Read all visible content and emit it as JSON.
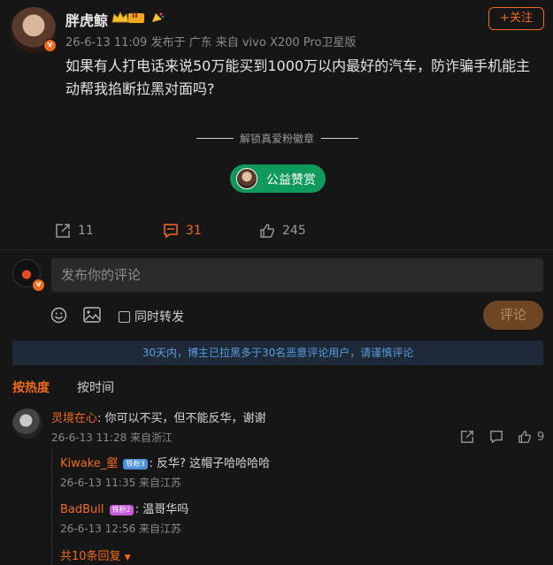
{
  "post": {
    "username": "胖虎鲸",
    "level_badge": "II",
    "meta": "26-6-13 11:09  发布于 广东  来自 vivo X200 Pro卫星版",
    "follow_label": "+关注",
    "body": "如果有人打电话来说50万能买到1000万以内最好的汽车，防诈骗手机能主动帮我掐断拉黑对面吗?",
    "unlock_text": "解锁真爱粉徽章",
    "charity_label": "公益赞赏",
    "actions": {
      "repost_count": "11",
      "comment_count": "31",
      "like_count": "245"
    }
  },
  "composer": {
    "placeholder": "发布你的评论",
    "repost_label": "同时转发",
    "submit_label": "评论"
  },
  "notice": "30天内，博主已拉黑多于30名恶意评论用户，请谨慎评论",
  "sort_tabs": [
    {
      "label": "按热度",
      "active": true
    },
    {
      "label": "按时间",
      "active": false
    }
  ],
  "comments": [
    {
      "name": "灵境在心",
      "text": ": 你可以不买，但不能反华，谢谢",
      "meta": "26-6-13 11:28 来自浙江",
      "like_count": "9",
      "replies": [
        {
          "name": "Kiwake_壑",
          "badge": "铁粉3",
          "text": ": 反华? 这帽子哈哈哈哈",
          "meta": "26-6-13 11:35 来自江苏"
        },
        {
          "name": "BadBull",
          "badge": "铁粉2",
          "text": ": 温哥华吗",
          "meta": "26-6-13 12:56 来自江苏"
        }
      ],
      "more_replies": "共10条回复"
    }
  ],
  "colors": {
    "accent": "#f26a1b",
    "background": "#161616",
    "charity_green": "#0f9a5c",
    "notice_blue": "#5a9be0"
  },
  "icons": [
    "repost-icon",
    "comment-icon",
    "like-icon",
    "emoji-icon",
    "image-icon",
    "share-icon",
    "reply-icon",
    "vip-crown-icon",
    "fan-badge-icon"
  ]
}
